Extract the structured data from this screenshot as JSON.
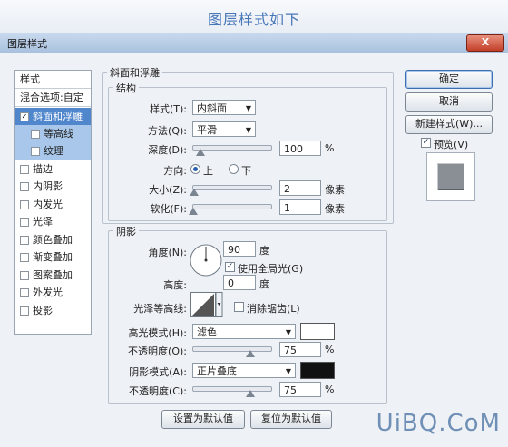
{
  "caption": "图层样式如下",
  "window": {
    "title": "图层样式",
    "close": "X"
  },
  "left_panel": {
    "header": "样式",
    "blend_options": "混合选项:自定",
    "items": [
      {
        "label": "斜面和浮雕",
        "checked": true,
        "selected": true
      },
      {
        "label": "等高线",
        "checked": false,
        "sub": true
      },
      {
        "label": "纹理",
        "checked": false,
        "sub": true
      },
      {
        "label": "描边",
        "checked": false
      },
      {
        "label": "内阴影",
        "checked": false
      },
      {
        "label": "内发光",
        "checked": false
      },
      {
        "label": "光泽",
        "checked": false
      },
      {
        "label": "颜色叠加",
        "checked": false
      },
      {
        "label": "渐变叠加",
        "checked": false
      },
      {
        "label": "图案叠加",
        "checked": false
      },
      {
        "label": "外发光",
        "checked": false
      },
      {
        "label": "投影",
        "checked": false
      }
    ]
  },
  "bevel": {
    "group_title": "斜面和浮雕",
    "structure_title": "结构",
    "style_label": "样式(T):",
    "style_value": "内斜面",
    "technique_label": "方法(Q):",
    "technique_value": "平滑",
    "depth_label": "深度(D):",
    "depth_value": "100",
    "depth_unit": "%",
    "direction_label": "方向:",
    "dir_up": "上",
    "dir_down": "下",
    "size_label": "大小(Z):",
    "size_value": "2",
    "size_unit": "像素",
    "soften_label": "软化(F):",
    "soften_value": "1",
    "soften_unit": "像素"
  },
  "shading": {
    "title": "阴影",
    "angle_label": "角度(N):",
    "angle_value": "90",
    "angle_unit": "度",
    "global_light_label": "使用全局光(G)",
    "altitude_label": "高度:",
    "altitude_value": "0",
    "altitude_unit": "度",
    "gloss_label": "光泽等高线:",
    "antialias_label": "消除锯齿(L)",
    "highlight_label": "高光模式(H):",
    "highlight_value": "滤色",
    "highlight_color": "#ffffff",
    "opacity1_label": "不透明度(O):",
    "opacity1_value": "75",
    "opacity1_unit": "%",
    "shadow_label": "阴影模式(A):",
    "shadow_value": "正片叠底",
    "shadow_color": "#111111",
    "opacity2_label": "不透明度(C):",
    "opacity2_value": "75",
    "opacity2_unit": "%"
  },
  "footer": {
    "make_default": "设置为默认值",
    "reset_default": "复位为默认值"
  },
  "right": {
    "ok": "确定",
    "cancel": "取消",
    "new_style": "新建样式(W)...",
    "preview": "预览(V)"
  },
  "watermark": "UiBQ.CoM"
}
